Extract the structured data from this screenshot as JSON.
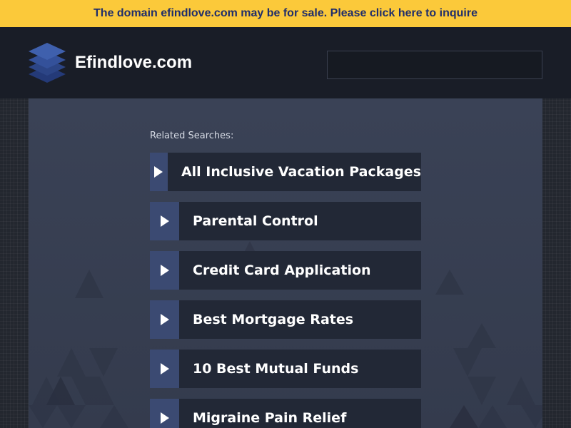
{
  "banner": {
    "text": "The domain efindlove.com may be for sale. Please click here to inquire",
    "bg_color": "#fbc93a",
    "text_color": "#1f2d6b"
  },
  "header": {
    "logo_icon": "stacked-layers-icon",
    "site_title": "Efindlove.com",
    "search_placeholder": ""
  },
  "related": {
    "label": "Related Searches:",
    "items": [
      {
        "label": "All Inclusive Vacation Packages",
        "icon": "play-arrow-icon"
      },
      {
        "label": "Parental Control",
        "icon": "play-arrow-icon"
      },
      {
        "label": "Credit Card Application",
        "icon": "play-arrow-icon"
      },
      {
        "label": "Best Mortgage Rates",
        "icon": "play-arrow-icon"
      },
      {
        "label": "10 Best Mutual Funds",
        "icon": "play-arrow-icon"
      },
      {
        "label": "Migraine Pain Relief",
        "icon": "play-arrow-icon"
      }
    ]
  },
  "colors": {
    "header_bg": "#191d27",
    "content_bg": "#3a4256",
    "arrow_block": "#3b4a72",
    "link_block": "#222836"
  }
}
